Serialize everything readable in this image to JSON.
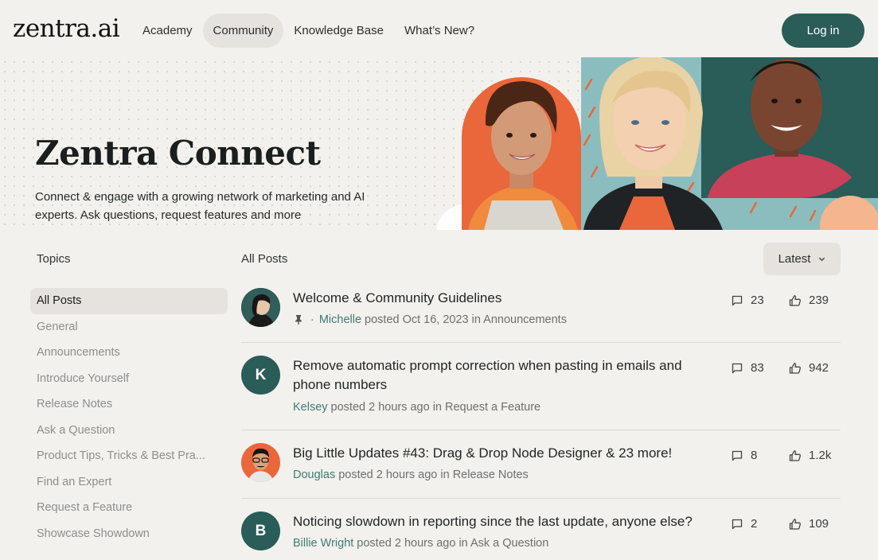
{
  "brand": {
    "logo": "zentra.ai",
    "accent": "#2a5c58"
  },
  "nav": {
    "links": [
      "Academy",
      "Community",
      "Knowledge Base",
      "What’s New?"
    ],
    "active": "Community",
    "login_label": "Log in"
  },
  "hero": {
    "title": "Zentra Connect",
    "description": "Connect & engage with a growing network of marketing and AI experts. Ask questions, request features and more"
  },
  "sidebar": {
    "heading": "Topics",
    "items": [
      "All Posts",
      "General",
      "Announcements",
      "Introduce Yourself",
      "Release Notes",
      "Ask a Question",
      "Product Tips, Tricks & Best Pra...",
      "Find an Expert",
      "Request a Feature",
      "Showcase Showdown"
    ],
    "active": "All Posts"
  },
  "main": {
    "heading": "All Posts",
    "sort_label": "Latest",
    "posts": [
      {
        "title": "Welcome & Community Guidelines",
        "pinned": true,
        "separator": "·",
        "author": "Michelle",
        "meta_rest": "posted Oct 16, 2023 in Announcements",
        "comments": "23",
        "likes": "239",
        "avatar": "photo"
      },
      {
        "title": "Remove automatic prompt correction when pasting in emails and phone numbers",
        "pinned": false,
        "author": "Kelsey",
        "meta_rest": "posted 2 hours ago in Request a Feature",
        "comments": "83",
        "likes": "942",
        "avatar": "K"
      },
      {
        "title": "Big Little Updates #43: Drag & Drop Node Designer & 23 more!",
        "pinned": false,
        "author": "Douglas",
        "meta_rest": "posted 2 hours ago in Release Notes",
        "comments": "8",
        "likes": "1.2k",
        "avatar": "photo"
      },
      {
        "title": "Noticing slowdown in reporting since the last update, anyone else?",
        "pinned": false,
        "author": "Billie Wright",
        "meta_rest": "posted 2 hours ago in Ask a Question",
        "comments": "2",
        "likes": "109",
        "avatar": "B"
      }
    ]
  }
}
